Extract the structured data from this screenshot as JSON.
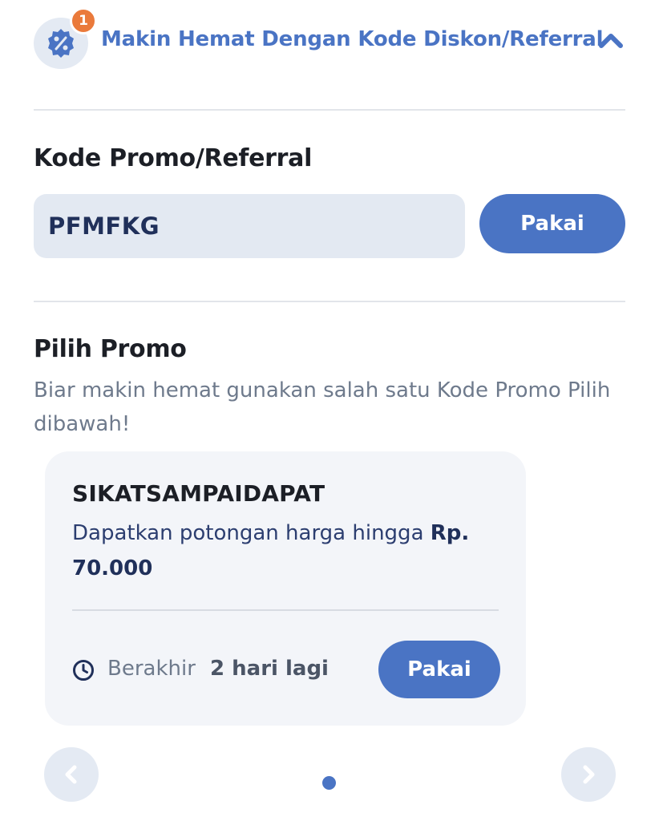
{
  "header": {
    "badge_count": "1",
    "title": "Makin Hemat Dengan Kode Diskon/Referral",
    "icon": "discount-badge-icon",
    "toggle_icon": "chevron-up-icon"
  },
  "code_section": {
    "title": "Kode Promo/Referral",
    "input_value": "PFMFKG",
    "apply_label": "Pakai"
  },
  "promo_section": {
    "title": "Pilih Promo",
    "description": "Biar makin hemat gunakan salah satu Kode Promo Pilih dibawah!",
    "promos": [
      {
        "code": "SIKATSAMPAIDAPAT",
        "description_prefix": "Dapatkan potongan harga hingga ",
        "amount": "Rp. 70.000",
        "expire_label": "Berakhir",
        "expire_value": "2 hari lagi",
        "apply_label": "Pakai"
      }
    ],
    "pagination": {
      "current": 1,
      "total": 1
    }
  },
  "colors": {
    "accent": "#4a74c4",
    "badge": "#ea7a3b",
    "input_bg": "#e3e9f2",
    "card_bg": "#f3f5f9"
  }
}
